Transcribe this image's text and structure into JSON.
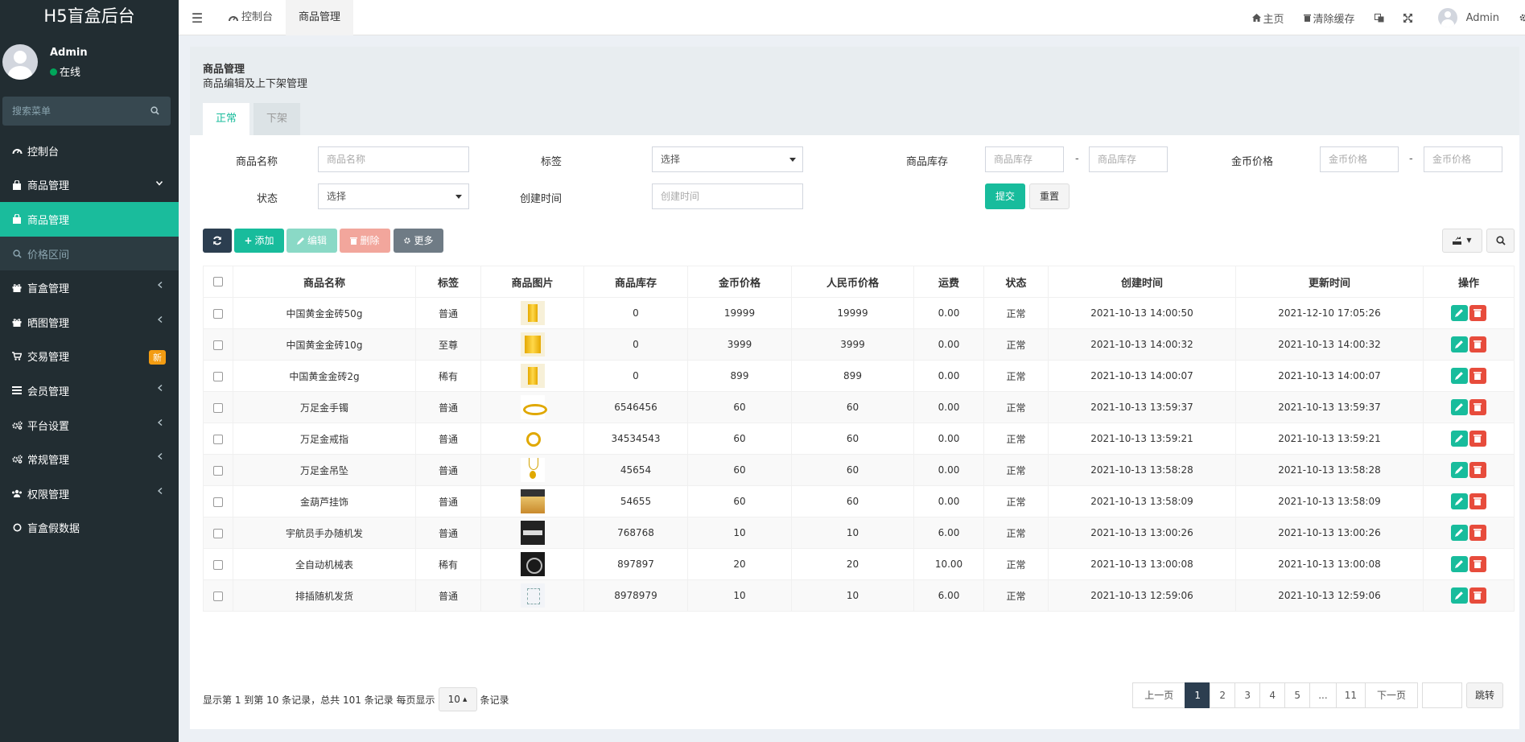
{
  "brand": "H5盲盒后台",
  "user": {
    "name": "Admin",
    "status": "在线"
  },
  "sidebar": {
    "search_placeholder": "搜索菜单",
    "items": [
      {
        "label": "控制台",
        "icon": "dashboard-icon"
      },
      {
        "label": "商品管理",
        "icon": "bag-icon",
        "arrow": "chevron-down"
      },
      {
        "label": "商品管理",
        "icon": "bag-icon",
        "active": true
      },
      {
        "label": "价格区间",
        "icon": "search-icon",
        "sub": true
      },
      {
        "label": "盲盒管理",
        "icon": "gift-icon",
        "arrow": "chevron-left"
      },
      {
        "label": "晒图管理",
        "icon": "gift-icon",
        "arrow": "chevron-left"
      },
      {
        "label": "交易管理",
        "icon": "cart-icon",
        "badge": "新"
      },
      {
        "label": "会员管理",
        "icon": "list-icon",
        "arrow": "chevron-left"
      },
      {
        "label": "平台设置",
        "icon": "cogs-icon",
        "arrow": "chevron-left"
      },
      {
        "label": "常规管理",
        "icon": "cogs-icon",
        "arrow": "chevron-left"
      },
      {
        "label": "权限管理",
        "icon": "users-icon",
        "arrow": "chevron-left"
      },
      {
        "label": "盲盒假数据",
        "icon": "circle-icon"
      }
    ]
  },
  "topbar": {
    "tabs": [
      {
        "label": "控制台"
      },
      {
        "label": "商品管理"
      }
    ],
    "home": "主页",
    "clear_cache": "清除缓存",
    "user": "Admin"
  },
  "panel": {
    "title": "商品管理",
    "desc": "商品编辑及上下架管理",
    "tabs": [
      "正常",
      "下架"
    ]
  },
  "filters": {
    "name_label": "商品名称",
    "name_placeholder": "商品名称",
    "tag_label": "标签",
    "tag_value": "选择",
    "stock_label": "商品库存",
    "stock_placeholder": "商品库存",
    "price_label": "金币价格",
    "price_placeholder": "金币价格",
    "status_label": "状态",
    "status_value": "选择",
    "created_label": "创建时间",
    "created_placeholder": "创建时间",
    "dash": "-",
    "submit": "提交",
    "reset": "重置"
  },
  "toolbar": {
    "add": "添加",
    "edit": "编辑",
    "delete": "删除",
    "more": "更多"
  },
  "table": {
    "columns": [
      "商品名称",
      "标签",
      "商品图片",
      "商品库存",
      "金币价格",
      "人民币价格",
      "运费",
      "状态",
      "创建时间",
      "更新时间",
      "操作"
    ],
    "rows": [
      {
        "name": "中国黄金金砖50g",
        "tag": "普通",
        "tag_type": "normal",
        "img": "gold",
        "stock": "0",
        "coin": "19999",
        "rmb": "19999",
        "fee": "0.00",
        "status": "正常",
        "created": "2021-10-13 14:00:50",
        "updated": "2021-12-10 17:05:26"
      },
      {
        "name": "中国黄金金砖10g",
        "tag": "至尊",
        "tag_type": "zhizun",
        "img": "gold2",
        "stock": "0",
        "coin": "3999",
        "rmb": "3999",
        "fee": "0.00",
        "status": "正常",
        "created": "2021-10-13 14:00:32",
        "updated": "2021-10-13 14:00:32"
      },
      {
        "name": "中国黄金金砖2g",
        "tag": "稀有",
        "tag_type": "xiyou",
        "img": "gold",
        "stock": "0",
        "coin": "899",
        "rmb": "899",
        "fee": "0.00",
        "status": "正常",
        "created": "2021-10-13 14:00:07",
        "updated": "2021-10-13 14:00:07"
      },
      {
        "name": "万足金手镯",
        "tag": "普通",
        "tag_type": "normal",
        "img": "brace",
        "stock": "6546456",
        "coin": "60",
        "rmb": "60",
        "fee": "0.00",
        "status": "正常",
        "created": "2021-10-13 13:59:37",
        "updated": "2021-10-13 13:59:37"
      },
      {
        "name": "万足金戒指",
        "tag": "普通",
        "tag_type": "normal",
        "img": "ring",
        "stock": "34534543",
        "coin": "60",
        "rmb": "60",
        "fee": "0.00",
        "status": "正常",
        "created": "2021-10-13 13:59:21",
        "updated": "2021-10-13 13:59:21"
      },
      {
        "name": "万足金吊坠",
        "tag": "普通",
        "tag_type": "normal",
        "img": "pend",
        "stock": "45654",
        "coin": "60",
        "rmb": "60",
        "fee": "0.00",
        "status": "正常",
        "created": "2021-10-13 13:58:28",
        "updated": "2021-10-13 13:58:28"
      },
      {
        "name": "金葫芦挂饰",
        "tag": "普通",
        "tag_type": "normal",
        "img": "gourd",
        "stock": "54655",
        "coin": "60",
        "rmb": "60",
        "fee": "0.00",
        "status": "正常",
        "created": "2021-10-13 13:58:09",
        "updated": "2021-10-13 13:58:09"
      },
      {
        "name": "宇航员手办随机发",
        "tag": "普通",
        "tag_type": "normal",
        "img": "dark",
        "stock": "768768",
        "coin": "10",
        "rmb": "10",
        "fee": "6.00",
        "status": "正常",
        "created": "2021-10-13 13:00:26",
        "updated": "2021-10-13 13:00:26"
      },
      {
        "name": "全自动机械表",
        "tag": "稀有",
        "tag_type": "xiyou",
        "img": "watch",
        "stock": "897897",
        "coin": "20",
        "rmb": "20",
        "fee": "10.00",
        "status": "正常",
        "created": "2021-10-13 13:00:08",
        "updated": "2021-10-13 13:00:08"
      },
      {
        "name": "排插随机发货",
        "tag": "普通",
        "tag_type": "normal",
        "img": "light",
        "stock": "8978979",
        "coin": "10",
        "rmb": "10",
        "fee": "6.00",
        "status": "正常",
        "created": "2021-10-13 12:59:06",
        "updated": "2021-10-13 12:59:06"
      }
    ]
  },
  "footer": {
    "summary": "显示第 1 到第 10 条记录，总共 101 条记录 每页显示",
    "page_size": "10",
    "suffix": "条记录"
  },
  "pagination": {
    "prev": "上一页",
    "pages": [
      "1",
      "2",
      "3",
      "4",
      "5",
      "...",
      "11"
    ],
    "next": "下一页",
    "jump": "跳转"
  },
  "colors": {
    "accent": "#18bc9c",
    "sidebar": "#222d32",
    "danger": "#e74c3c",
    "dark": "#2c3e50"
  }
}
